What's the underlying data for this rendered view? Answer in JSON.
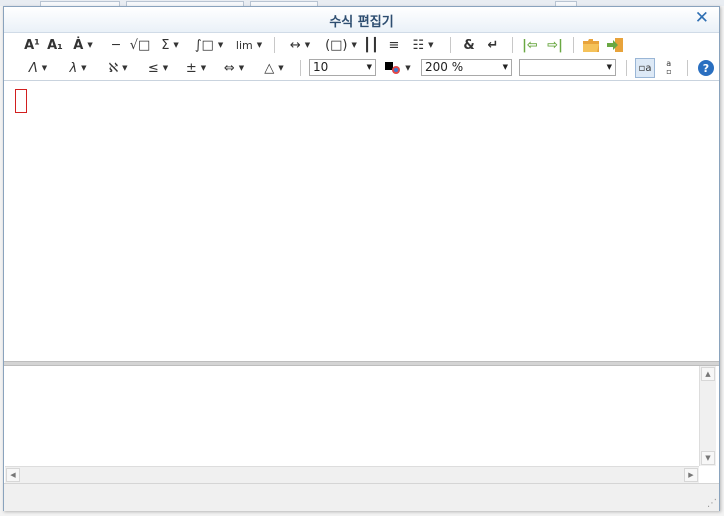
{
  "window": {
    "title": "수식 편집기"
  },
  "toolbar1": {
    "superscript": "A¹",
    "subscript": "A₁",
    "accent": "Ȧ",
    "fraction": "╶╴",
    "root": "√□",
    "sum": "Σ",
    "integral": "∫□",
    "limit": "lim",
    "bracket": "↔",
    "paren": "(□)",
    "matrix": "┃┃",
    "column": "≡",
    "grid": "☷",
    "ampersand": "&",
    "newline": "↵",
    "prev": "|⇦",
    "next": "⇨|",
    "open": "📂",
    "export": "→"
  },
  "toolbar2": {
    "greek_upper": "Λ",
    "greek_lower": "λ",
    "hebrew": "ℵ",
    "relation": "≤",
    "operator": "±",
    "arrow": "⇔",
    "misc": "△",
    "font_size": "10",
    "zoom": "200 %",
    "font_name": "",
    "help": "?"
  },
  "editor": {
    "script_text": ""
  },
  "colors": {
    "title": "#2d4d70",
    "cursor": "#d21f1f",
    "accent": "#2a6fc0"
  }
}
